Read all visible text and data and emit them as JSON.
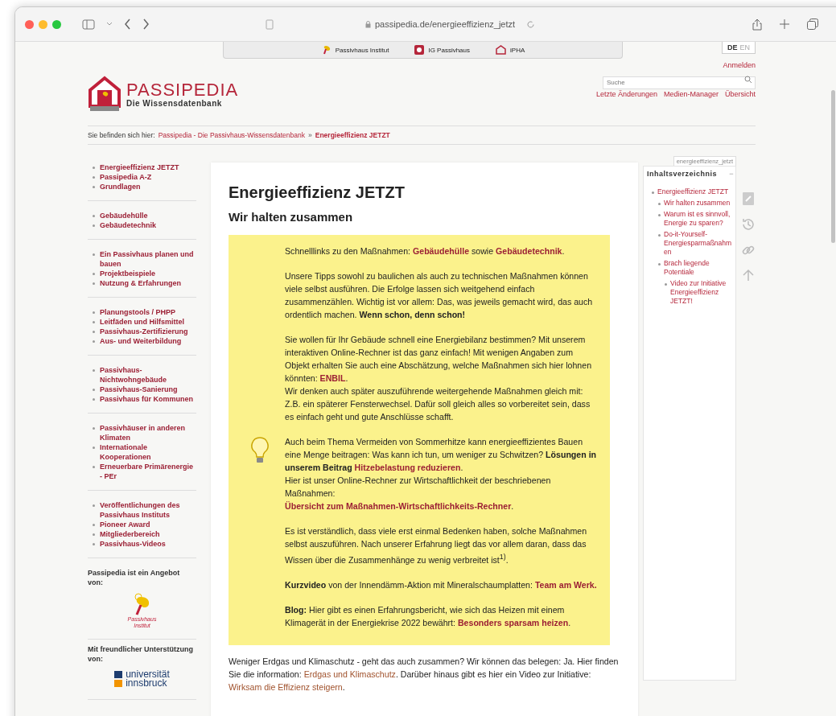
{
  "browser": {
    "url": "passipedia.de/energieeffizienz_jetzt"
  },
  "top_links": [
    {
      "label": "Passivhaus Institut"
    },
    {
      "label": "IG Passivhaus"
    },
    {
      "label": "iPHA"
    }
  ],
  "languages": [
    {
      "label": "DE",
      "selected": true
    },
    {
      "label": "EN",
      "selected": false
    }
  ],
  "login": "Anmelden",
  "search": {
    "placeholder": "Suche"
  },
  "tools": [
    "Letzte Änderungen",
    "Medien-Manager",
    "Übersicht"
  ],
  "logo": {
    "title": "PASSIPEDIA",
    "subtitle": "Die Wissensdatenbank"
  },
  "breadcrumb": {
    "label": "Sie befinden sich hier:",
    "items": [
      {
        "label": "Passipedia - Die Passivhaus-Wissensdatenbank",
        "current": false
      },
      {
        "label": "Energieeffizienz JETZT",
        "current": true
      }
    ],
    "separator": "»"
  },
  "sidebar": {
    "groups": [
      [
        "Energieeffizienz JETZT",
        "Passipedia A-Z",
        "Grundlagen"
      ],
      [
        "Gebäudehülle",
        "Gebäudetechnik"
      ],
      [
        "Ein Passivhaus planen und bauen",
        "Projektbeispiele",
        "Nutzung & Erfahrungen"
      ],
      [
        "Planungstools / PHPP",
        "Leitfäden und Hilfsmittel",
        "Passivhaus-Zertifizierung",
        "Aus- und Weiterbildung"
      ],
      [
        "Passivhaus-Nichtwohngebäude",
        "Passivhaus-Sanierung",
        "Passivhaus für Kommunen"
      ],
      [
        "Passivhäuser in anderen Klimaten",
        "Internationale Kooperationen",
        "Erneuerbare Primärenergie - PEr"
      ],
      [
        "Veröffentlichungen des Passivhaus Instituts",
        "Pioneer Award",
        "Mitgliederbereich",
        "Passivhaus-Videos"
      ]
    ],
    "sponsors": [
      {
        "label": "Passipedia ist ein Angebot von:",
        "logo_text": [
          "Passivhaus",
          "Institut"
        ]
      },
      {
        "label": "Mit freundlicher Unterstützung von:",
        "logo_text": [
          "universität",
          "innsbruck"
        ]
      }
    ]
  },
  "page_id": "energieeffizienz_jetzt",
  "title": "Energieeffizienz JETZT",
  "subtitle": "Wir halten zusammen",
  "box_paragraphs": [
    {
      "kind": "plain",
      "parts": [
        {
          "kind": "text",
          "s": "Schnelllinks zu den Maßnahmen: "
        },
        {
          "kind": "link",
          "s": "Gebäudehülle"
        },
        {
          "kind": "text",
          "s": " sowie "
        },
        {
          "kind": "link",
          "s": "Gebäudetechnik"
        },
        {
          "kind": "text",
          "s": "."
        }
      ]
    },
    {
      "kind": "plain",
      "parts": [
        {
          "kind": "text",
          "s": "Unsere Tipps sowohl zu baulichen als auch zu technischen Maßnahmen können viele selbst ausführen. Die Erfolge lassen sich weitgehend einfach zusammenzählen. Wichtig ist vor allem: Das, was jeweils gemacht wird, das auch ordentlich machen. **Wenn schon, denn schon!**"
        }
      ]
    },
    {
      "kind": "plain",
      "parts": [
        {
          "kind": "text",
          "s": "Sie wollen für Ihr Gebäude schnell eine Energiebilanz bestimmen? Mit unserem interaktiven Online-Rechner ist das ganz einfach! Mit wenigen Angaben zum Objekt erhalten Sie auch eine Abschätzung, welche Maßnahmen sich hier lohnen könnten: "
        },
        {
          "kind": "link",
          "s": "ENBIL"
        },
        {
          "kind": "text",
          "s": "."
        },
        {
          "kind": "br"
        },
        {
          "kind": "text",
          "s": "Wir denken auch später auszuführende weitergehende Maßnahmen gleich mit: Z.B. ein späterer Fensterwechsel. Dafür soll gleich alles so vorbereitet sein, dass es einfach geht und gute Anschlüsse schafft."
        }
      ]
    },
    {
      "kind": "tip",
      "parts": [
        {
          "kind": "text",
          "s": "Auch beim Thema Vermeiden von Sommerhitze kann energieeffizientes Bauen eine Menge beitragen: Was kann ich tun, um weniger zu Schwitzen? **Lösungen in unserem Beitrag** "
        },
        {
          "kind": "link",
          "s": "Hitzebelastung reduzieren"
        },
        {
          "kind": "text",
          "s": "."
        },
        {
          "kind": "br"
        },
        {
          "kind": "text",
          "s": "Hier ist unser Online-Rechner zur Wirtschaftlichkeit der beschriebenen Maßnahmen:"
        },
        {
          "kind": "br"
        },
        {
          "kind": "link",
          "s": "Übersicht zum Maßnahmen-Wirtschaftlichkeits-Rechner"
        },
        {
          "kind": "text",
          "s": "."
        }
      ]
    },
    {
      "kind": "plain",
      "parts": [
        {
          "kind": "text",
          "s": "Es ist verständlich, dass viele erst einmal Bedenken haben, solche Maßnahmen selbst auszuführen. Nach unserer Erfahrung liegt das vor allem daran, dass das Wissen über die Zusammenhänge zu wenig verbreitet ist$^{1)}$."
        }
      ]
    },
    {
      "kind": "plain",
      "parts": [
        {
          "kind": "text",
          "s": "**Kurzvideo** von der Innendämm-Aktion mit Mineralschaumplatten: "
        },
        {
          "kind": "link",
          "s": "Team am Werk."
        }
      ]
    },
    {
      "kind": "plain",
      "parts": [
        {
          "kind": "text",
          "s": "**Blog:** Hier gibt es einen Erfahrungsbericht, wie sich das Heizen mit einem Klimagerät in der Energiekrise 2022 bewährt: "
        },
        {
          "kind": "link",
          "s": "Besonders sparsam heizen"
        },
        {
          "kind": "text",
          "s": "."
        }
      ]
    }
  ],
  "after_box": {
    "parts": [
      {
        "kind": "text",
        "s": "Weniger Erdgas und Klimaschutz - geht das auch zusammen? Wir können das belegen: Ja. Hier finden Sie die information: "
      },
      {
        "kind": "link",
        "s": "Erdgas und Klimaschutz"
      },
      {
        "kind": "text",
        "s": ". Darüber hinaus gibt es hier ein Video zur Initiative: "
      },
      {
        "kind": "link",
        "s": "Wirksam die Effizienz steigern"
      },
      {
        "kind": "text",
        "s": "."
      }
    ]
  },
  "toc": {
    "title": "Inhaltsverzeichnis",
    "toggle": "−",
    "items": [
      {
        "label": "Energieeffizienz JETZT",
        "children": [
          {
            "label": "Wir halten zusammen"
          },
          {
            "label": "Warum ist es sinnvoll, Energie zu sparen?"
          },
          {
            "label": "Do-it-Yourself-Energiesparmaßnahmen"
          },
          {
            "label": "Brach liegende Potentiale",
            "children": [
              {
                "label": "Video zur Initiative Energieeffizienz JETZT!"
              }
            ]
          }
        ]
      }
    ]
  }
}
